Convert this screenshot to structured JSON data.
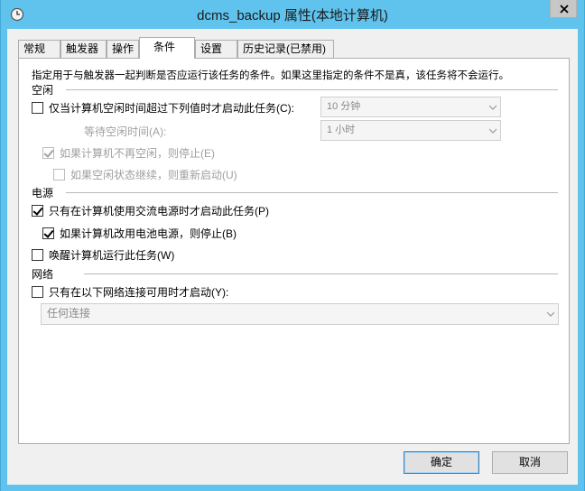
{
  "window": {
    "title": "dcms_backup 属性(本地计算机)"
  },
  "tabs": [
    "常规",
    "触发器",
    "操作",
    "条件",
    "设置",
    "历史记录(已禁用)"
  ],
  "active_tab": "条件",
  "description": "指定用于与触发器一起判断是否应运行该任务的条件。如果这里指定的条件不是真，该任务将不会运行。",
  "idle": {
    "group": "空闲",
    "start_if_idle": {
      "label": "仅当计算机空闲时间超过下列值时才启动此任务(C):",
      "checked": false
    },
    "idle_duration": "10 分钟",
    "wait_label": "等待空闲时间(A):",
    "wait_value": "1 小时",
    "stop_if_not_idle": {
      "label": "如果计算机不再空闲，则停止(E)",
      "checked": true,
      "enabled": false
    },
    "restart_if_idle": {
      "label": "如果空闲状态继续，则重新启动(U)",
      "checked": false,
      "enabled": false
    }
  },
  "power": {
    "group": "电源",
    "ac_only": {
      "label": "只有在计算机使用交流电源时才启动此任务(P)",
      "checked": true
    },
    "stop_on_battery": {
      "label": "如果计算机改用电池电源，则停止(B)",
      "checked": true
    },
    "wake": {
      "label": "唤醒计算机运行此任务(W)",
      "checked": false
    }
  },
  "network": {
    "group": "网络",
    "only_if_network": {
      "label": "只有在以下网络连接可用时才启动(Y):",
      "checked": false
    },
    "connection": "任何连接"
  },
  "buttons": {
    "ok": "确定",
    "cancel": "取消"
  },
  "colors": {
    "titlebar": "#5fc3ee",
    "client": "#f0f0f0"
  }
}
